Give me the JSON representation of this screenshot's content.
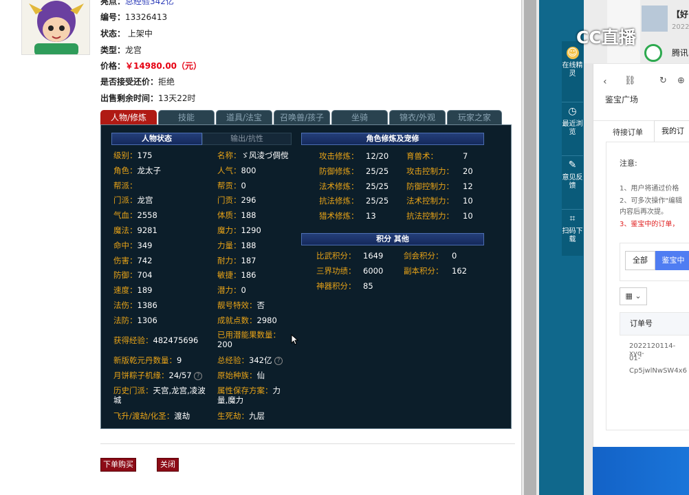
{
  "char": {
    "title_frag": "总经验342亿",
    "id_label": "编号：",
    "id": "13326413",
    "status_label": "状态：",
    "status": "上架中",
    "type_label": "类型：",
    "type": "龙宫",
    "price_label": "价格：",
    "price": "￥14980.00（元）",
    "bargain_label": "是否接受还价：",
    "bargain": "拒绝",
    "remain_label": "出售剩余时间：",
    "remain": "13天22时"
  },
  "tabs": [
    "人物/修炼",
    "技能",
    "道具/法宝",
    "召唤兽/孩子",
    "坐骑",
    "锦衣/外观",
    "玩家之家"
  ],
  "panel": {
    "state_header": "人物状态",
    "sub_a": "输出/抗性",
    "cultivate_header": "角色修炼及宠修",
    "score_header": "积分 其他",
    "col1": [
      [
        "级别：",
        "175"
      ],
      [
        "角色：",
        "龙太子"
      ],
      [
        "帮派：",
        ""
      ],
      [
        "门派：",
        "龙宫"
      ],
      [
        "气血：",
        "2558"
      ],
      [
        "魔法：",
        "9281"
      ],
      [
        "命中：",
        "349"
      ],
      [
        "伤害：",
        "742"
      ],
      [
        "防御：",
        "704"
      ],
      [
        "速度：",
        "189"
      ],
      [
        "法伤：",
        "1386"
      ],
      [
        "法防：",
        "1306"
      ]
    ],
    "col2": [
      [
        "名称：",
        "ゞ风淩づ倜傥"
      ],
      [
        "人气：",
        "800"
      ],
      [
        "帮贡：",
        "0"
      ],
      [
        "门贡：",
        "296"
      ],
      [
        "体质：",
        "188"
      ],
      [
        "魔力：",
        "1290"
      ],
      [
        "力量：",
        "188"
      ],
      [
        "耐力：",
        "187"
      ],
      [
        "敏捷：",
        "186"
      ],
      [
        "潜力：",
        "0"
      ],
      [
        "靓号特效：",
        "否"
      ],
      [
        "成就点数：",
        "2980"
      ]
    ],
    "exp_label": "获得经验：",
    "exp": "482475696",
    "potion_label": "已用潜能果数量：",
    "potion": "200",
    "qiankun_label": "新版乾元丹数量：",
    "qiankun": "9",
    "total_exp_label": "总经验：",
    "total_exp": "342亿",
    "zongzi_label": "月饼粽子机缘：",
    "zongzi": "24/57",
    "race_label": "原始种族：",
    "race": "仙",
    "history_label": "历史门派：",
    "history": "天宫,龙宫,凌波城",
    "attr_label": "属性保存方案：",
    "attr": "力量,魔力",
    "fly_label": "飞升/渡劫/化圣：",
    "fly": "渡劫",
    "life_label": "生死劫：",
    "life": "九层",
    "cult": [
      [
        "攻击修炼：",
        "12/20"
      ],
      [
        "防御修炼：",
        "25/25"
      ],
      [
        "法术修炼：",
        "25/25"
      ],
      [
        "抗法修炼：",
        "25/25"
      ],
      [
        "猎术修炼：",
        "13"
      ]
    ],
    "pet": [
      [
        "育兽术：",
        "7"
      ],
      [
        "攻击控制力：",
        "20"
      ],
      [
        "防御控制力：",
        "12"
      ],
      [
        "法术控制力：",
        "10"
      ],
      [
        "抗法控制力：",
        "10"
      ]
    ],
    "score": [
      [
        "比武积分：",
        "1649"
      ],
      [
        "三界功绩：",
        "6000"
      ],
      [
        "神器积分：",
        "85"
      ]
    ],
    "score2": [
      [
        "剑会积分：",
        "0"
      ],
      [
        "副本积分：",
        "162"
      ]
    ]
  },
  "buttons": {
    "buy": "下单购买",
    "close": "关闭"
  },
  "dock": [
    {
      "label": "在线精灵",
      "icon": "avatar-icon"
    },
    {
      "label": "最近浏览",
      "icon": "clock-icon"
    },
    {
      "label": "意见反馈",
      "icon": "edit-icon"
    },
    {
      "label": "扫码下载",
      "icon": "scan-icon"
    }
  ],
  "right": {
    "cc_logo": "CC直播",
    "title_frag": "【好",
    "date_frag": "2022",
    "tencent": "腾讯",
    "page_title": "鉴宝广场",
    "tab_pending": "待接订单",
    "tab_mine": "我的订",
    "notice": "注意:",
    "n1": "1、用户将通过价格",
    "n2": "2、可多次操作\"编辑",
    "n2b": "内容后再次提。",
    "n3": "3、鉴宝中的订单，",
    "filter_all": "全部",
    "filter_active": "鉴宝中",
    "col_order": "订单号",
    "order1": "2022120114-xyq-",
    "order2": "01-",
    "order3": "Cp5jwlNwSW4x6"
  }
}
